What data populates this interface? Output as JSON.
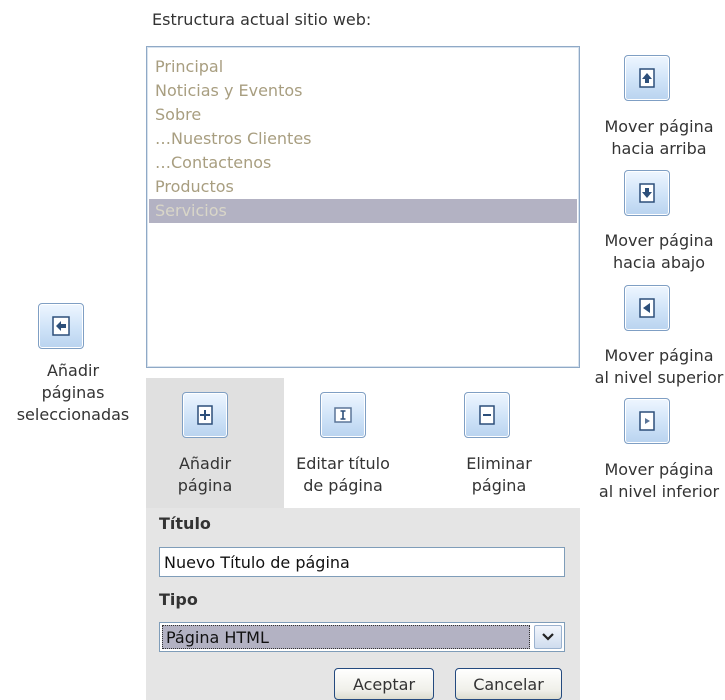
{
  "structure_label": "Estructura actual sitio web:",
  "pages": [
    {
      "label": "Principal",
      "selected": false
    },
    {
      "label": "Noticias y Eventos",
      "selected": false
    },
    {
      "label": "Sobre",
      "selected": false
    },
    {
      "label": "…Nuestros Clientes",
      "selected": false
    },
    {
      "label": "…Contactenos",
      "selected": false
    },
    {
      "label": "Productos",
      "selected": false
    },
    {
      "label": "Servicios",
      "selected": true
    }
  ],
  "add_selected": {
    "caption_line1": "Añadir",
    "caption_line2": "páginas",
    "caption_line3": "seleccionadas"
  },
  "move_up": {
    "caption_line1": "Mover página",
    "caption_line2": "hacia arriba"
  },
  "move_down": {
    "caption_line1": "Mover página",
    "caption_line2": "hacia abajo"
  },
  "move_higher": {
    "caption_line1": "Mover página",
    "caption_line2": "al nivel superior"
  },
  "move_lower": {
    "caption_line1": "Mover página",
    "caption_line2": "al nivel inferior"
  },
  "add_page": {
    "caption_line1": "Añadir",
    "caption_line2": "página"
  },
  "edit_title": {
    "caption_line1": "Editar título",
    "caption_line2": "de página"
  },
  "delete_page": {
    "caption_line1": "Eliminar",
    "caption_line2": "página"
  },
  "form": {
    "title_label": "Título",
    "title_value": "Nuevo Título de página",
    "type_label": "Tipo",
    "type_value": "Página HTML"
  },
  "buttons": {
    "accept": "Aceptar",
    "cancel": "Cancelar"
  },
  "colors": {
    "selection": "#b3b2c3",
    "list_text": "#a89e80",
    "button_border": "#7f9fc4",
    "panel_gray": "#e5e5e5"
  },
  "icons": {
    "add_selected": "page-arrow-icon",
    "move_up": "page-up-icon",
    "move_down": "page-down-icon",
    "move_higher": "arrow-left-icon",
    "move_lower": "arrow-right-icon",
    "add_page": "plus-icon",
    "edit_title": "text-cursor-icon",
    "delete_page": "minus-icon",
    "select_arrow": "chevron-down-icon"
  }
}
